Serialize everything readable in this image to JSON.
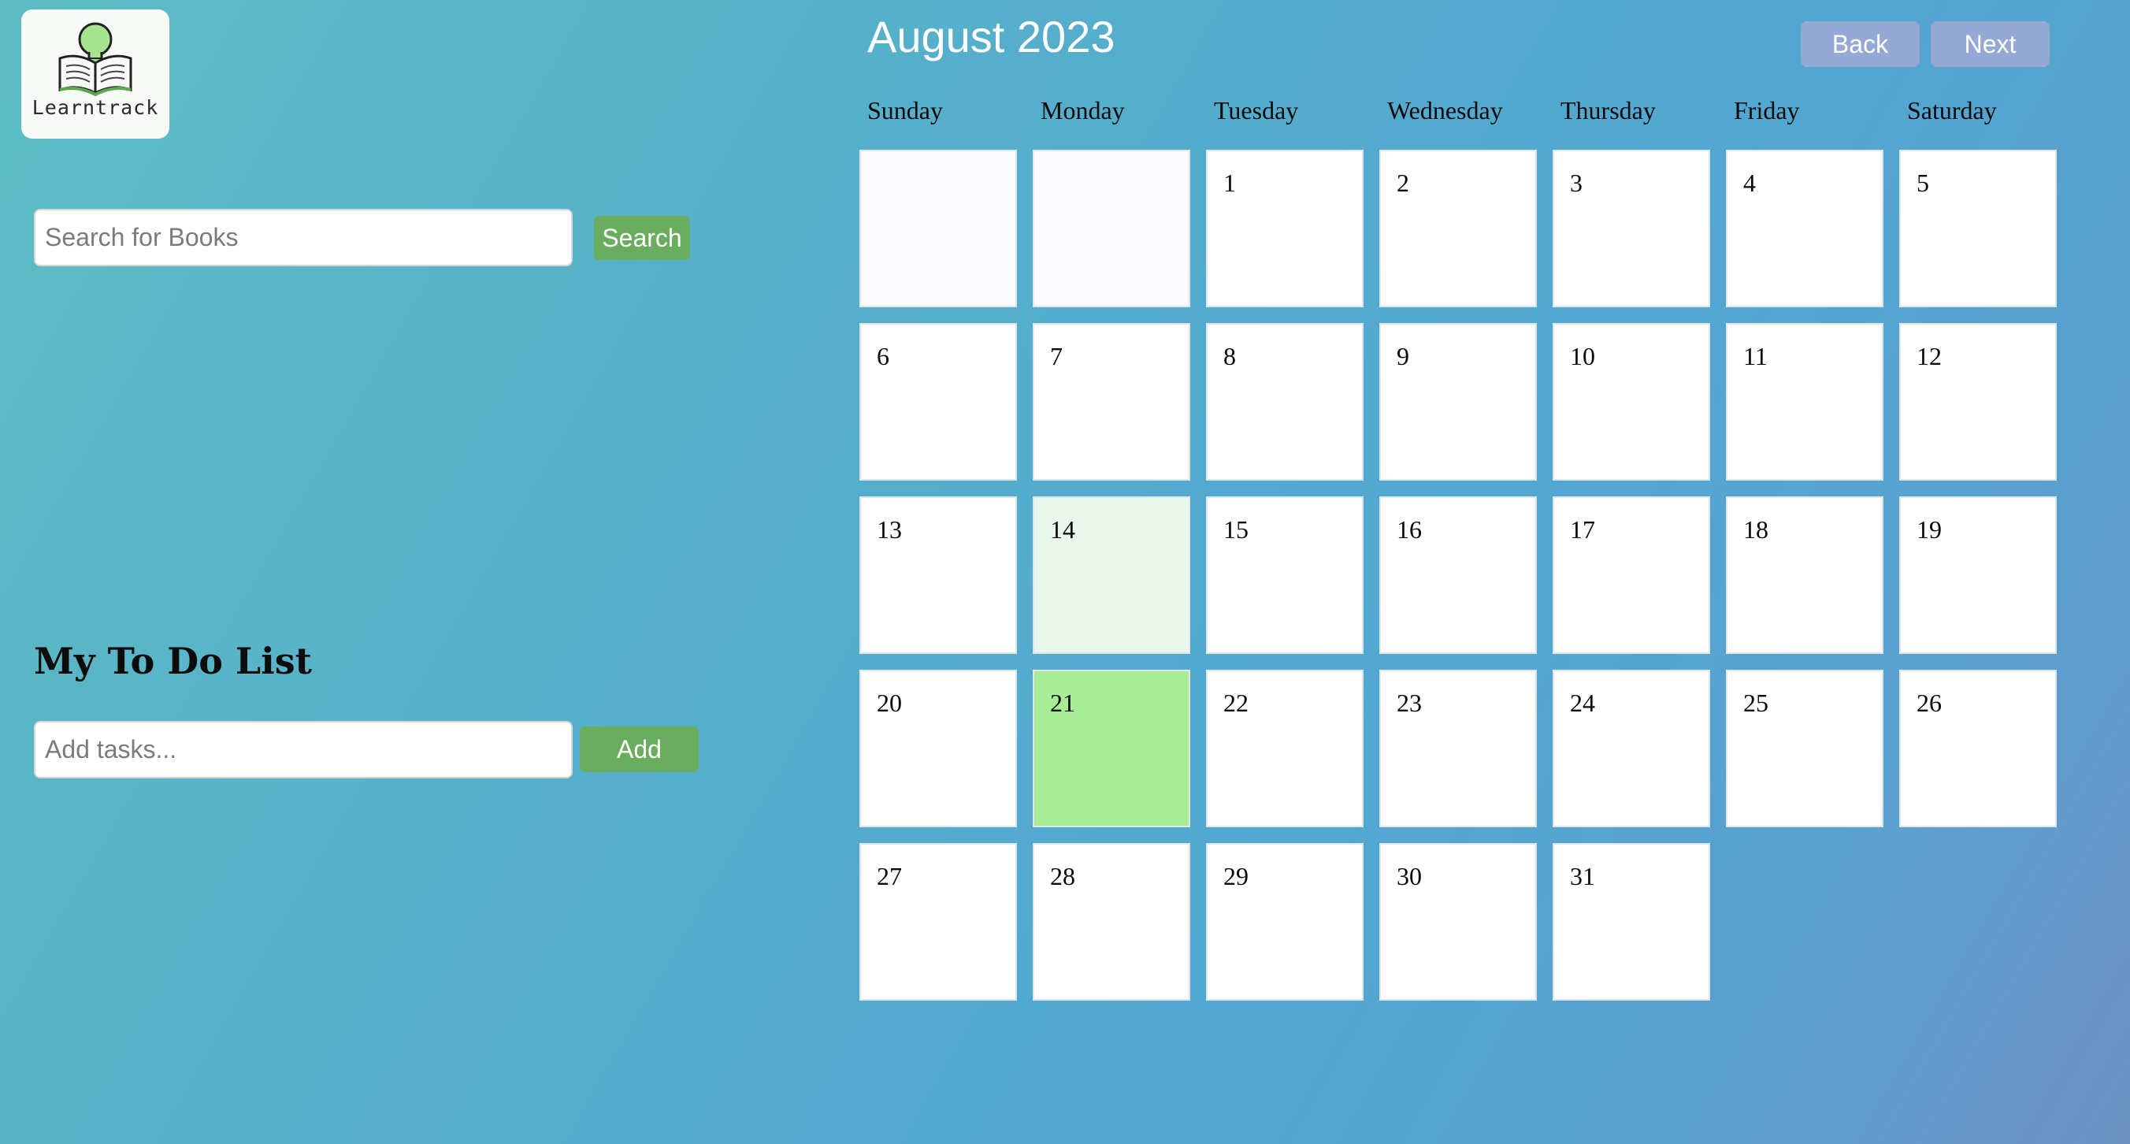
{
  "logo": {
    "text": "Learntrack"
  },
  "search": {
    "placeholder": "Search for Books",
    "button_label": "Search"
  },
  "todo": {
    "title": "My To Do List",
    "placeholder": "Add tasks...",
    "button_label": "Add"
  },
  "calendar": {
    "month_title": "August 2023",
    "back_label": "Back",
    "next_label": "Next",
    "weekdays": [
      "Sunday",
      "Monday",
      "Tuesday",
      "Wednesday",
      "Thursday",
      "Friday",
      "Saturday"
    ],
    "days": [
      "",
      "",
      "1",
      "2",
      "3",
      "4",
      "5",
      "6",
      "7",
      "8",
      "9",
      "10",
      "11",
      "12",
      "13",
      "14",
      "15",
      "16",
      "17",
      "18",
      "19",
      "20",
      "21",
      "22",
      "23",
      "24",
      "25",
      "26",
      "27",
      "28",
      "29",
      "30",
      "31"
    ]
  },
  "colors": {
    "button_green": "#6aad5e",
    "nav_button": "#95a9d4",
    "today_highlight": "#a8ec95",
    "light_highlight": "#eaf7ec"
  }
}
